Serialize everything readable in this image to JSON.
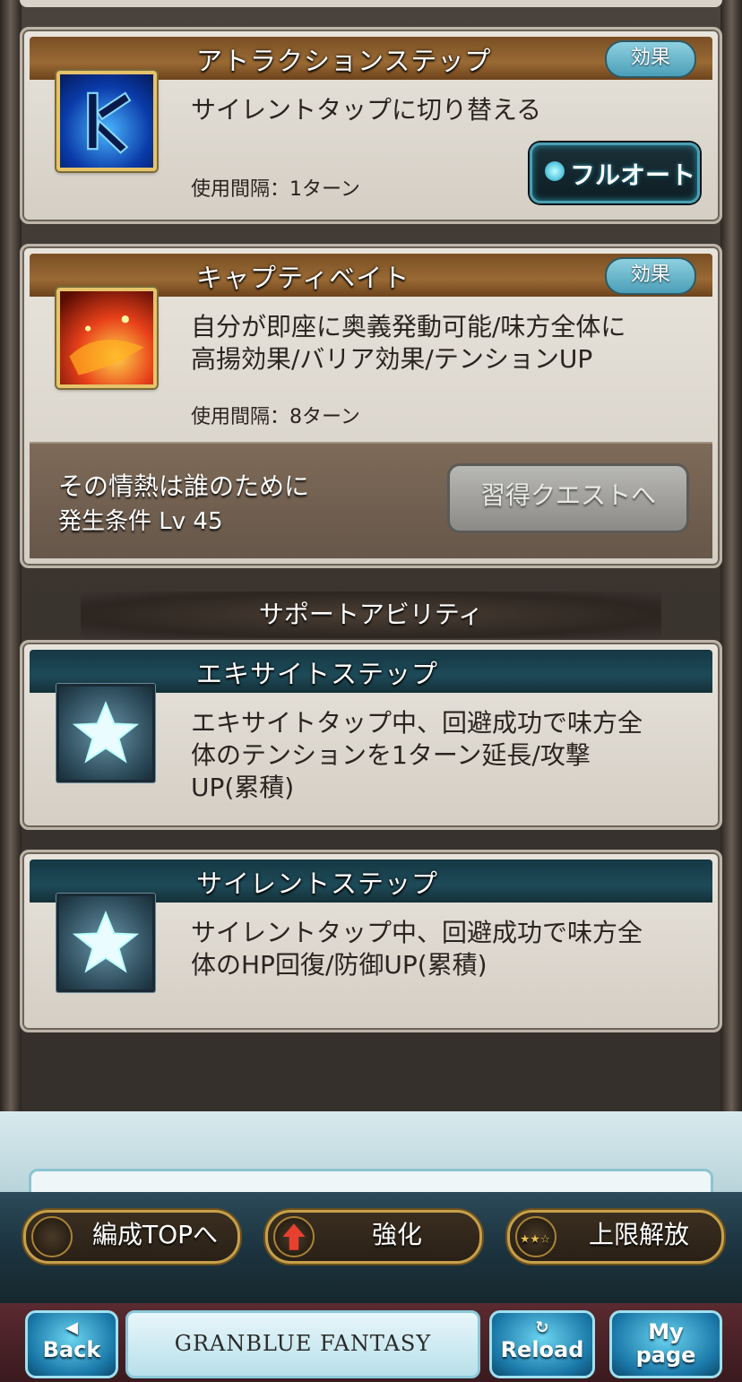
{
  "abilities": [
    {
      "title": "アトラクションステップ",
      "badge": "効果",
      "desc": "サイレントタップに切り替える",
      "interval": "使用間隔：1ターン",
      "icon": "blue-rune-icon",
      "toggle_label": "フルオート"
    },
    {
      "title": "キャプティベイト",
      "badge": "効果",
      "desc_line1": "自分が即座に奥義発動可能/味方全体に",
      "desc_line2": "高揚効果/バリア効果/テンションUP",
      "interval": "使用間隔：8ターン",
      "icon": "fire-burst-icon",
      "quest_title": "その情熱は誰のために",
      "quest_condition": "発生条件 Lv 45",
      "quest_button": "習得クエストへ"
    }
  ],
  "support_section_title": "サポートアビリティ",
  "supports": [
    {
      "title": "エキサイトステップ",
      "desc_line1": "エキサイトタップ中、回避成功で味方全",
      "desc_line2": "体のテンションを1ターン延長/攻撃",
      "desc_line3": "UP(累積)",
      "icon": "star-icon"
    },
    {
      "title": "サイレントステップ",
      "desc_line1": "サイレントタップ中、回避成功で味方全",
      "desc_line2": "体のHP回復/防御UP(累積)",
      "icon": "star-icon"
    }
  ],
  "menu": {
    "party_top": "編成TOPへ",
    "enhance": "強化",
    "uncap": "上限解放"
  },
  "nav": {
    "back": "Back",
    "logo": "GRANBLUE FANTASY",
    "reload": "Reload",
    "mypage_line1": "My",
    "mypage_line2": "page"
  },
  "colors": {
    "badge": "#5ab4c8",
    "header_brown": "#8a5a2a",
    "header_teal": "#1e4a58",
    "menu_gold": "#c8a04a",
    "nav_blue": "#2a90c0"
  }
}
